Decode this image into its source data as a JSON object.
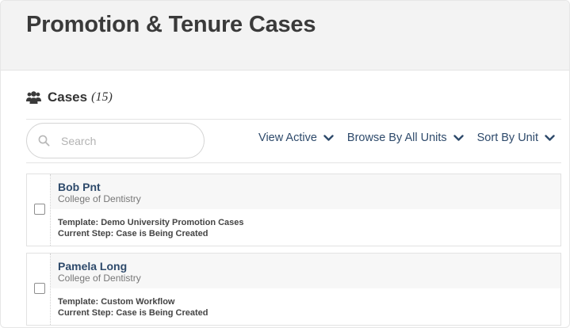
{
  "header": {
    "title": "Promotion & Tenure Cases"
  },
  "section": {
    "icon": "users-icon",
    "label": "Cases",
    "count": "(15)"
  },
  "search": {
    "placeholder": "Search",
    "value": ""
  },
  "toolbar": {
    "view": {
      "label": "View Active",
      "icon": "chevron-down-icon"
    },
    "browse": {
      "label": "Browse By All Units",
      "icon": "chevron-down-icon"
    },
    "sort": {
      "label": "Sort By Unit",
      "icon": "chevron-down-icon"
    }
  },
  "colors": {
    "link": "#2e4a6b",
    "header_bg": "#f3f3f3",
    "title": "#3a3a3a"
  },
  "cases": [
    {
      "name": "Bob Pnt",
      "unit": "College of Dentistry",
      "template": "Template: Demo University Promotion Cases",
      "step": "Current Step: Case is Being Created",
      "checked": false
    },
    {
      "name": "Pamela Long",
      "unit": "College of Dentistry",
      "template": "Template: Custom Workflow",
      "step": "Current Step: Case is Being Created",
      "checked": false
    }
  ]
}
